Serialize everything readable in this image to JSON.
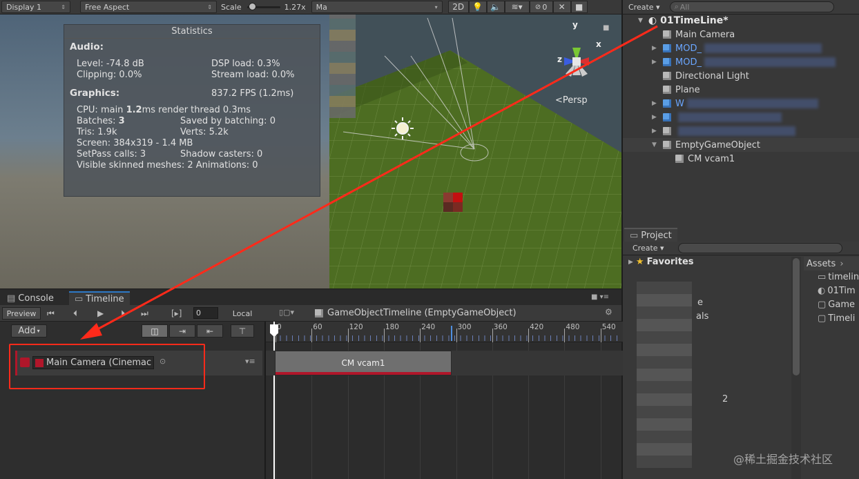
{
  "scene_toolbar": {
    "display": "Display 1",
    "aspect": "Free Aspect",
    "scale_label": "Scale",
    "scale_value": "1.27x",
    "maximize_partial": "Ma",
    "mode_2d": "2D",
    "effects_count": "0"
  },
  "statistics": {
    "title": "Statistics",
    "audio_heading": "Audio:",
    "level": "Level: -74.8 dB",
    "clipping": "Clipping: 0.0%",
    "dsp_load": "DSP load: 0.3%",
    "stream_load": "Stream load: 0.0%",
    "graphics_heading": "Graphics:",
    "fps": "837.2 FPS (1.2ms)",
    "cpu_prefix": "CPU: main ",
    "cpu_main": "1.2",
    "cpu_suffix": "ms  render thread 0.3ms",
    "batches_prefix": "Batches: ",
    "batches": "3",
    "saved_by_batching": "Saved by batching: 0",
    "tris": "Tris: 1.9k",
    "verts": "Verts: 5.2k",
    "screen": "Screen: 384x319 - 1.4 MB",
    "setpass": "SetPass calls: 3",
    "shadow_casters": "Shadow casters: 0",
    "skinned": "Visible skinned meshes: 2  Animations: 0"
  },
  "scene": {
    "persp_label": "<Persp",
    "axis_x": "x",
    "axis_y": "y",
    "axis_z": "z"
  },
  "hierarchy": {
    "create_label": "Create",
    "search_placeholder": "All",
    "scene_name": "01TimeLine*",
    "items": [
      {
        "label": "Main Camera",
        "expandable": false,
        "blue": false,
        "indent": 1
      },
      {
        "label": "MOD_",
        "expandable": true,
        "blue": true,
        "indent": 1
      },
      {
        "label": "MOD_",
        "expandable": true,
        "blue": true,
        "indent": 1
      },
      {
        "label": "Directional Light",
        "expandable": false,
        "blue": false,
        "indent": 1
      },
      {
        "label": "Plane",
        "expandable": false,
        "blue": false,
        "indent": 1
      },
      {
        "label": "W",
        "expandable": true,
        "blue": true,
        "indent": 1
      },
      {
        "label": "",
        "expandable": true,
        "blue": true,
        "indent": 1
      },
      {
        "label": "",
        "expandable": true,
        "blue": false,
        "indent": 1
      },
      {
        "label": "EmptyGameObject",
        "expandable": true,
        "blue": false,
        "indent": 1
      },
      {
        "label": "CM vcam1",
        "expandable": false,
        "blue": false,
        "indent": 2
      }
    ]
  },
  "project": {
    "tab_label": "Project",
    "create_label": "Create",
    "favorites": "Favorites",
    "assets_breadcrumb": "Assets",
    "asset_items": [
      "timelin",
      "01Tim",
      "Game",
      "Timeli"
    ],
    "folder_partial_1": "e",
    "folder_partial_2": "als",
    "folder_partial_3": "2"
  },
  "bottom_tabs": {
    "console": "Console",
    "timeline": "Timeline"
  },
  "timeline": {
    "preview_label": "Preview",
    "frame_value": "0",
    "local_label": "Local",
    "asset_title": "GameObjectTimeline (EmptyGameObject)",
    "add_label": "Add",
    "track_name": "Main Camera (Cinemac",
    "clip_label": "CM vcam1",
    "ruler": [
      "0",
      "60",
      "120",
      "180",
      "240",
      "300",
      "360",
      "420",
      "480",
      "540"
    ]
  },
  "watermark": "@稀土掘金技术社区",
  "colors": {
    "annotation_red": "#ff2a1a",
    "clip_underline": "#b0162a",
    "playhead": "#ffffff",
    "grid_green": "#4d6d22"
  }
}
